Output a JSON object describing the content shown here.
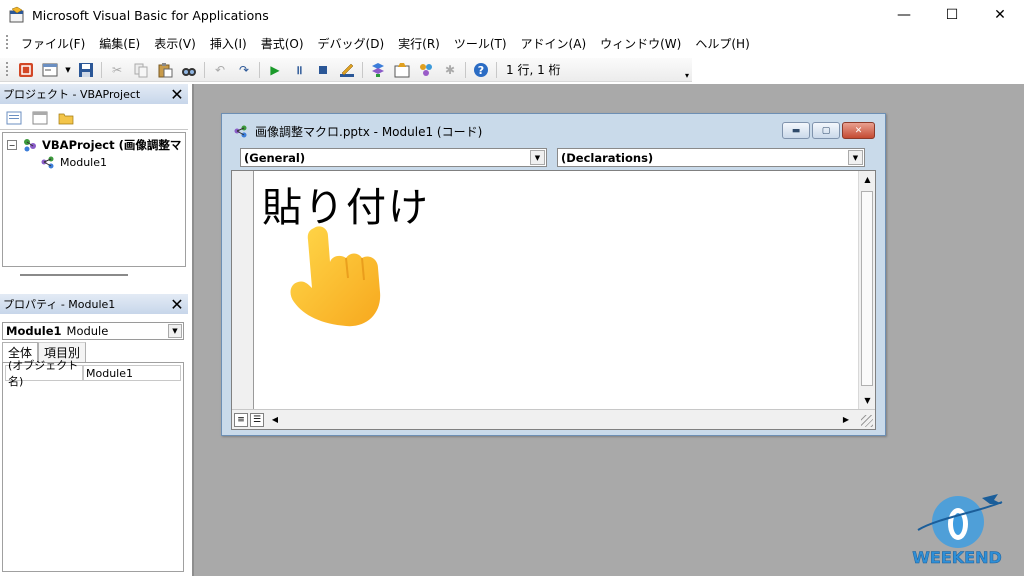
{
  "window": {
    "title": "Microsoft Visual Basic for Applications",
    "controls": {
      "minimize": "—",
      "maximize": "☐",
      "close": "✕"
    }
  },
  "menu": {
    "items": [
      "ファイル(F)",
      "編集(E)",
      "表示(V)",
      "挿入(I)",
      "書式(O)",
      "デバッグ(D)",
      "実行(R)",
      "ツール(T)",
      "アドイン(A)",
      "ウィンドウ(W)",
      "ヘルプ(H)"
    ]
  },
  "toolbar": {
    "cursor_position": "1 行, 1 桁"
  },
  "project_pane": {
    "title": "プロジェクト - VBAProject",
    "root_node": "VBAProject (画像調整マ",
    "child_node": "Module1",
    "expand_glyph": "⊟"
  },
  "properties_pane": {
    "title": "プロパティ - Module1",
    "object_select_name": "Module1",
    "object_select_type": "Module",
    "tabs": [
      "全体",
      "項目別"
    ],
    "row_name": "(オブジェクト名)",
    "row_value": "Module1"
  },
  "code_window": {
    "title": "画像調整マクロ.pptx - Module1 (コード)",
    "object_combo": "(General)",
    "procedure_combo": "(Declarations)",
    "overlay_text": "貼り付け"
  },
  "watermark": {
    "text": "WEEKEND"
  },
  "colors": {
    "mdi_background": "#a9a9a9",
    "code_window_frame": "#c9daea",
    "close_button": "#c44b33",
    "watermark_blue": "#2f8fd6"
  }
}
